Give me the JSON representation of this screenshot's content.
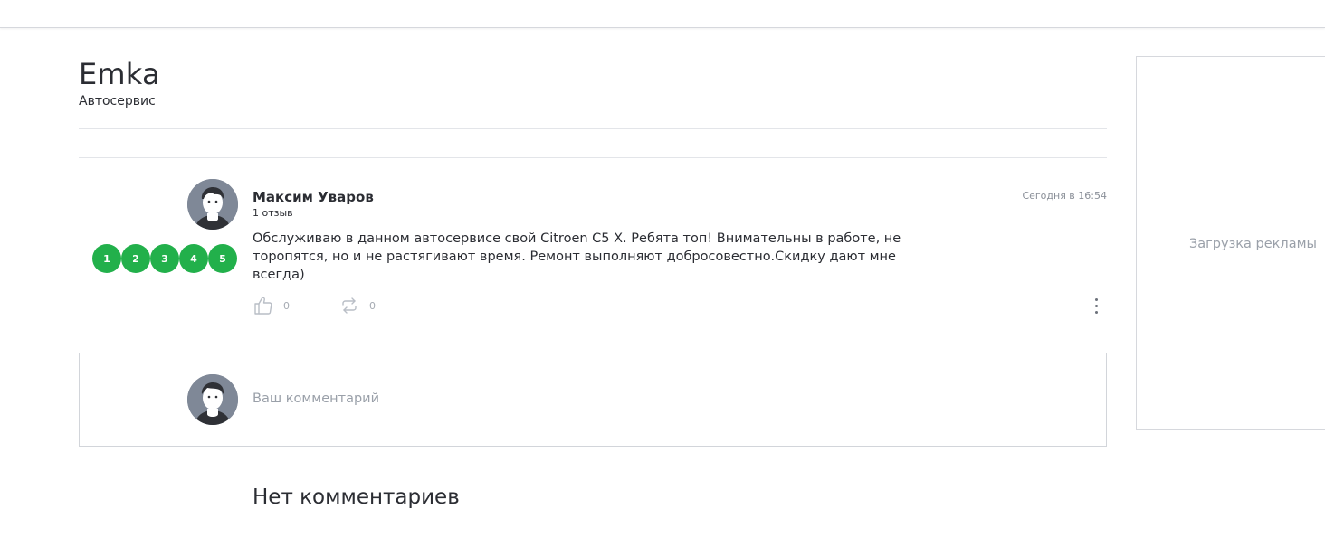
{
  "company": {
    "name": "Emka",
    "category": "Автосервис"
  },
  "review": {
    "author_name": "Максим Уваров",
    "author_reviews": "1 отзыв",
    "date": "Сегодня в 16:54",
    "text": "Обслуживаю в данном автосервисе свой Citroen C5 X. Ребята топ! Внимательны в работе, не торопятся, но и не растягивают время. Ремонт выполняют добросовестно.Скидку дают мне всегда)",
    "rating_labels": [
      "1",
      "2",
      "3",
      "4",
      "5"
    ],
    "rating_value": 5,
    "likes": "0",
    "reposts": "0"
  },
  "comment": {
    "placeholder": "Ваш комментарий"
  },
  "comments": {
    "empty_text": "Нет комментариев"
  },
  "ad": {
    "loading_text": "Загрузка рекламы"
  },
  "colors": {
    "rating_green": "#22b04b",
    "text": "#2b2d33",
    "muted": "#9aa0a9"
  },
  "icons": {
    "like": "thumbs-up-icon",
    "repost": "repeat-icon",
    "more": "more-vertical-icon",
    "avatar": "user-avatar-icon"
  }
}
